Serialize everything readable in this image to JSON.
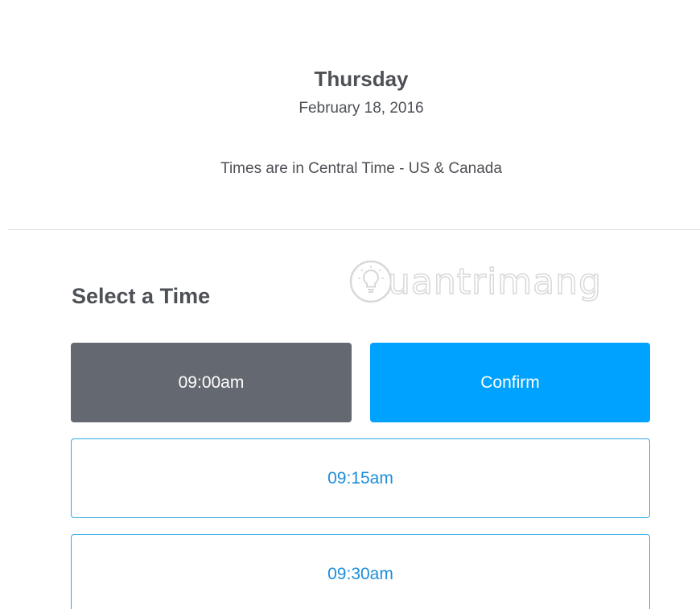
{
  "header": {
    "day": "Thursday",
    "date": "February 18, 2016",
    "timezone_note": "Times are in Central Time - US & Canada"
  },
  "section": {
    "title": "Select a Time"
  },
  "watermark": {
    "text": "uantrimang",
    "icon": "lightbulb-icon"
  },
  "selected_time": "09:00am",
  "confirm_label": "Confirm",
  "time_slots": [
    "09:15am",
    "09:30am"
  ],
  "colors": {
    "selected_bg": "#646870",
    "confirm_bg": "#00a2ff",
    "slot_border": "#32a9ea",
    "slot_text": "#1d8ddb",
    "text": "#4d5055"
  }
}
